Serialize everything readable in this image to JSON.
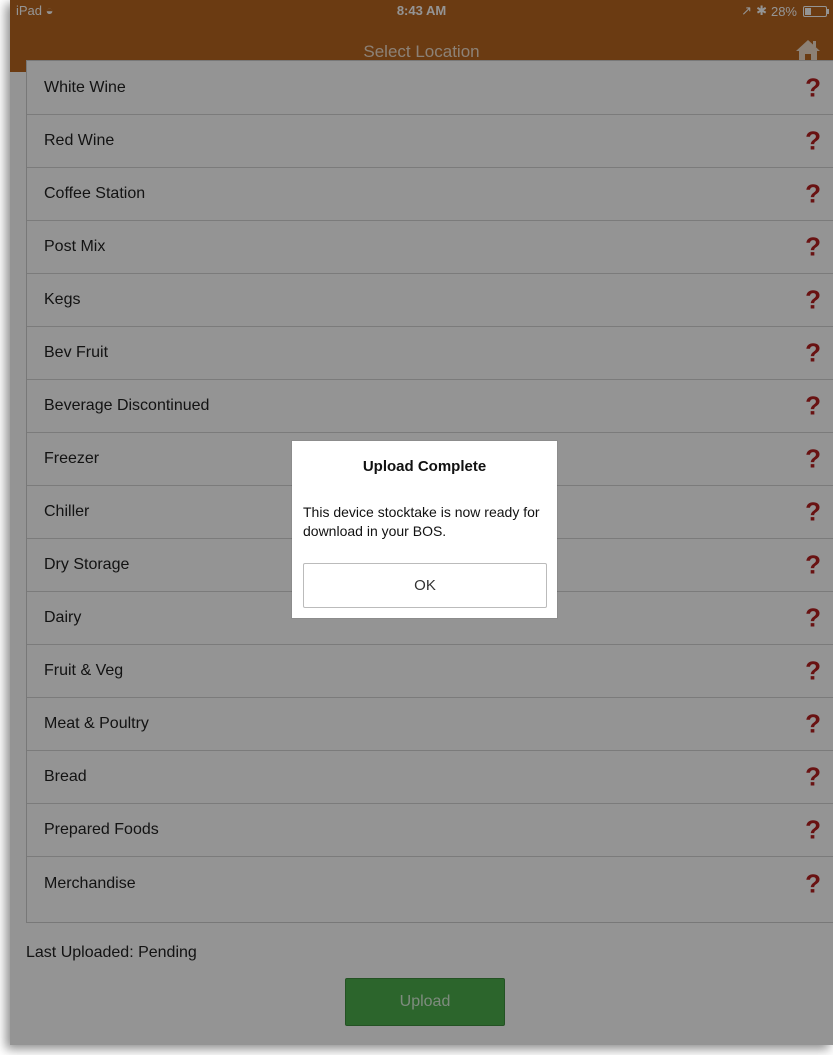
{
  "status_bar": {
    "device": "iPad",
    "time": "8:43 AM",
    "battery": "28%",
    "battery_level": 0.28
  },
  "nav": {
    "title": "Select Location",
    "home_icon": "home-icon"
  },
  "locations": [
    "White Wine",
    "Red Wine",
    "Coffee Station",
    "Post Mix",
    "Kegs",
    "Bev Fruit",
    "Beverage Discontinued",
    "Freezer",
    "Chiller",
    "Dry Storage",
    "Dairy",
    "Fruit & Veg",
    "Meat & Poultry",
    "Bread",
    "Prepared Foods",
    "Merchandise"
  ],
  "location_status_icon": "?",
  "last_uploaded": "Last Uploaded: Pending",
  "upload_label": "Upload",
  "alert": {
    "title": "Upload Complete",
    "message": "This device stocktake is now ready for download in your BOS.",
    "ok_label": "OK"
  },
  "colors": {
    "brand": "#b96620",
    "status_red": "#b51f1f",
    "upload_green": "#4cae4c"
  }
}
